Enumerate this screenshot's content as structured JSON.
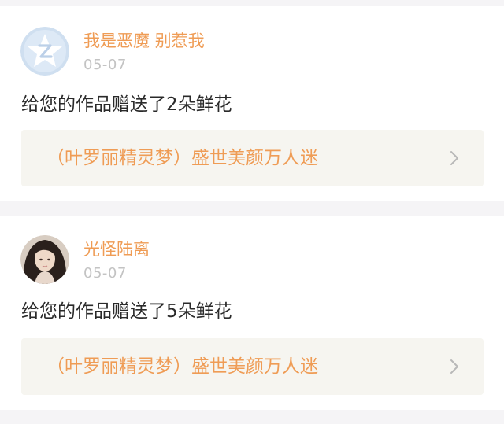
{
  "notifications": [
    {
      "username": "我是恶魔 别惹我",
      "date": "05-07",
      "message": "给您的作品赠送了2朵鲜花",
      "work_title": "（叶罗丽精灵梦）盛世美颜万人迷",
      "avatar_icon": "default-avatar-z-icon"
    },
    {
      "username": "光怪陆离",
      "date": "05-07",
      "message": "给您的作品赠送了5朵鲜花",
      "work_title": "（叶罗丽精灵梦）盛世美颜万人迷",
      "avatar_icon": "user-photo-avatar"
    }
  ],
  "colors": {
    "accent": "#ef9c55",
    "date": "#c3c3c3",
    "text": "#2a2a2a",
    "link_bg": "#f6f5f0",
    "page_bg": "#f5f4f6"
  }
}
